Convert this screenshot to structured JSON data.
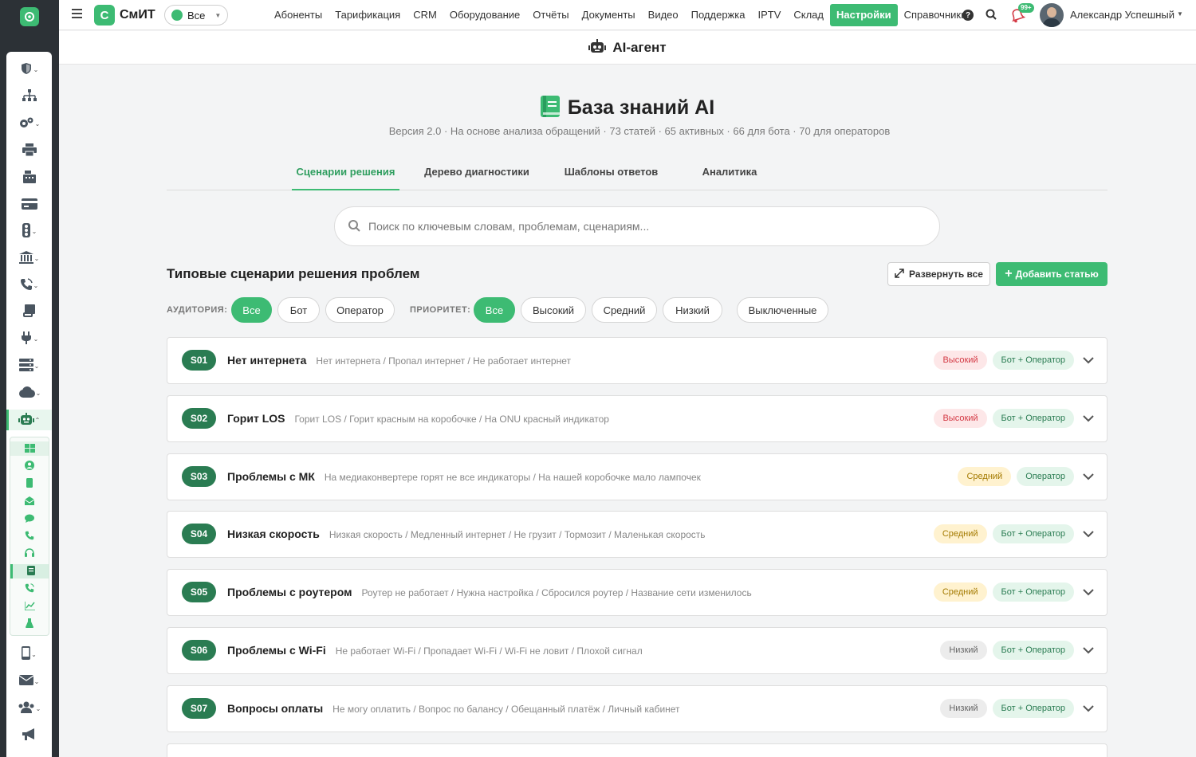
{
  "app": {
    "brand_letter": "С",
    "brand_name": "СмИТ",
    "scope": "Все"
  },
  "colors": {
    "accent": "#3dbb73",
    "accent_dark": "#2a7c52",
    "rail": "#2c3136",
    "high": "#d43a45",
    "medium": "#a47a00"
  },
  "nav": [
    "Абоненты",
    "Тарификация",
    "CRM",
    "Оборудование",
    "Отчёты",
    "Документы",
    "Видео",
    "Поддержка",
    "IPTV",
    "Склад",
    "Настройки",
    "Справочники"
  ],
  "nav_active": "Настройки",
  "topbar": {
    "notifications_badge": "99+",
    "help_icon": "question-circle-icon",
    "user_name": "Александр Успешный"
  },
  "sidebar": {
    "icons": [
      "shield-icon",
      "sitemap-icon",
      "cogs-icon",
      "printer-icon",
      "cash-register-icon",
      "credit-card-icon",
      "traffic-light-icon",
      "bank-icon",
      "phone-volume-icon",
      "scroll-icon",
      "plug-icon",
      "server-icon",
      "cloud-icon",
      "robot-icon",
      "mobile-icon",
      "envelope-icon",
      "users-icon",
      "bullhorn-icon"
    ],
    "active": "robot-icon",
    "sub_icons": [
      "grid-icon",
      "user-circle-icon",
      "mobile-icon",
      "mail-open-icon",
      "chat-icon",
      "phone-icon",
      "headset-icon",
      "book-icon",
      "phone-wave-icon",
      "chart-line-icon",
      "flask-icon"
    ],
    "sub_active": "book-icon"
  },
  "subheader": {
    "title": "AI-агент"
  },
  "kb": {
    "title": "База знаний AI",
    "subtitle": "Версия 2.0 · На основе анализа обращений · 73 статей · 65 активных · 66 для бота · 70 для операторов",
    "tabs": [
      "Сценарии решения",
      "Дерево диагностики",
      "Шаблоны ответов",
      "Аналитика"
    ],
    "active_tab": "Сценарии решения",
    "search_placeholder": "Поиск по ключевым словам, проблемам, сценариям...",
    "section_title": "Типовые сценарии решения проблем",
    "expand_all": "Развернуть все",
    "add_article": "Добавить статью",
    "audience_label": "АУДИТОРИЯ:",
    "audience": [
      "Все",
      "Бот",
      "Оператор"
    ],
    "priority_label": "ПРИОРИТЕТ:",
    "priority": [
      "Все",
      "Высокий",
      "Средний",
      "Низкий"
    ],
    "disabled": "Выключенные"
  },
  "scenarios": [
    {
      "code": "S01",
      "title": "Нет интернета",
      "keywords": "Нет интернета / Пропал интернет / Не работает интернет",
      "priority": "Высокий",
      "level": "high",
      "audience": "Бот + Оператор"
    },
    {
      "code": "S02",
      "title": "Горит LOS",
      "keywords": "Горит LOS / Горит красным на коробочке / На ONU красный индикатор",
      "priority": "Высокий",
      "level": "high",
      "audience": "Бот + Оператор"
    },
    {
      "code": "S03",
      "title": "Проблемы с МК",
      "keywords": "На медиаконвертере горят не все индикаторы / На нашей коробочке мало лампочек",
      "priority": "Средний",
      "level": "medium",
      "audience": "Оператор"
    },
    {
      "code": "S04",
      "title": "Низкая скорость",
      "keywords": "Низкая скорость / Медленный интернет / Не грузит / Тормозит / Маленькая скорость",
      "priority": "Средний",
      "level": "medium",
      "audience": "Бот + Оператор"
    },
    {
      "code": "S05",
      "title": "Проблемы с роутером",
      "keywords": "Роутер не работает / Нужна настройка / Сбросился роутер / Название сети изменилось",
      "priority": "Средний",
      "level": "medium",
      "audience": "Бот + Оператор"
    },
    {
      "code": "S06",
      "title": "Проблемы с Wi-Fi",
      "keywords": "Не работает Wi-Fi / Пропадает Wi-Fi / Wi-Fi не ловит / Плохой сигнал",
      "priority": "Низкий",
      "level": "low",
      "audience": "Бот + Оператор"
    },
    {
      "code": "S07",
      "title": "Вопросы оплаты",
      "keywords": "Не могу оплатить / Вопрос по балансу / Обещанный платёж / Личный кабинет",
      "priority": "Низкий",
      "level": "low",
      "audience": "Бот + Оператор"
    }
  ]
}
